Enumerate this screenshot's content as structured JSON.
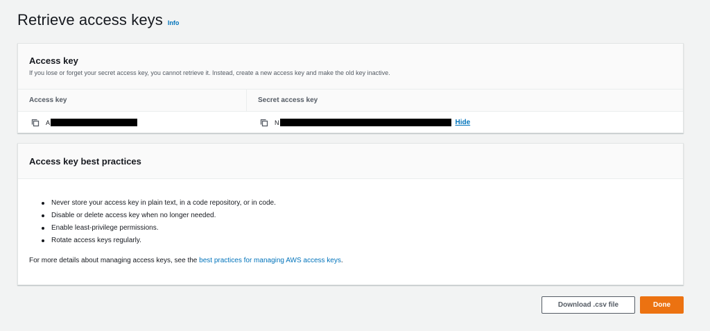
{
  "page": {
    "title": "Retrieve access keys",
    "info_label": "Info"
  },
  "access_key_card": {
    "title": "Access key",
    "description": "If you lose or forget your secret access key, you cannot retrieve it. Instead, create a new access key and make the old key inactive.",
    "columns": {
      "access_key_header": "Access key",
      "secret_key_header": "Secret access key"
    },
    "access_key_prefix": "A",
    "secret_key_prefix": "N",
    "hide_label": "Hide",
    "icons": [
      "copy-icon",
      "copy-icon"
    ]
  },
  "best_practices_card": {
    "title": "Access key best practices",
    "items": [
      "Never store your access key in plain text, in a code repository, or in code.",
      "Disable or delete access key when no longer needed.",
      "Enable least-privilege permissions.",
      "Rotate access keys regularly."
    ],
    "footer_prefix": "For more details about managing access keys, see the ",
    "footer_link": "best practices for managing AWS access keys",
    "footer_suffix": "."
  },
  "actions": {
    "download_label": "Download .csv file",
    "done_label": "Done"
  },
  "colors": {
    "link": "#0073bb",
    "primary_button": "#ec7211",
    "background": "#f2f3f3"
  }
}
